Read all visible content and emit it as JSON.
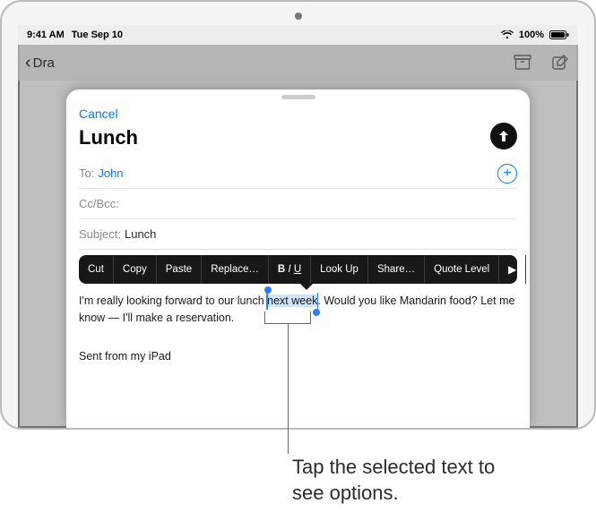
{
  "status": {
    "time": "9:41 AM",
    "date": "Tue Sep 10",
    "battery": "100%"
  },
  "nav": {
    "back_label": "Dra"
  },
  "compose": {
    "cancel": "Cancel",
    "title": "Lunch",
    "to_label": "To:",
    "to_value": "John",
    "ccbcc_label": "Cc/Bcc:",
    "subject_label": "Subject:",
    "subject_value": "Lunch"
  },
  "menu": {
    "cut": "Cut",
    "copy": "Copy",
    "paste": "Paste",
    "replace": "Replace…",
    "biu_b": "B",
    "biu_i": "I",
    "biu_u": "U",
    "lookup": "Look Up",
    "share": "Share…",
    "quote": "Quote Level"
  },
  "body": {
    "before": "I'm really looking forward to our lunch ",
    "selected": "next week",
    "after": ". Would you like Mandarin food? Let me know — I'll make a reservation.",
    "signature": "Sent from my iPad"
  },
  "callout": {
    "line1": "Tap the selected text to",
    "line2": "see options."
  }
}
